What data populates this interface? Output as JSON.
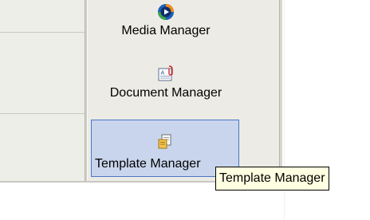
{
  "launcher": {
    "items": [
      {
        "label": "Media Manager",
        "icon": "media-player-icon"
      },
      {
        "label": "Document Manager",
        "icon": "document-icon"
      },
      {
        "label": "Template Manager",
        "icon": "template-icon",
        "state": "hover"
      }
    ]
  },
  "tooltip": {
    "text": "Template Manager"
  },
  "colors": {
    "panel_bg": "#ECEBE5",
    "selection_bg": "#C8D5EC",
    "selection_border": "#4A78C4",
    "tooltip_bg": "#FFFFE1"
  }
}
